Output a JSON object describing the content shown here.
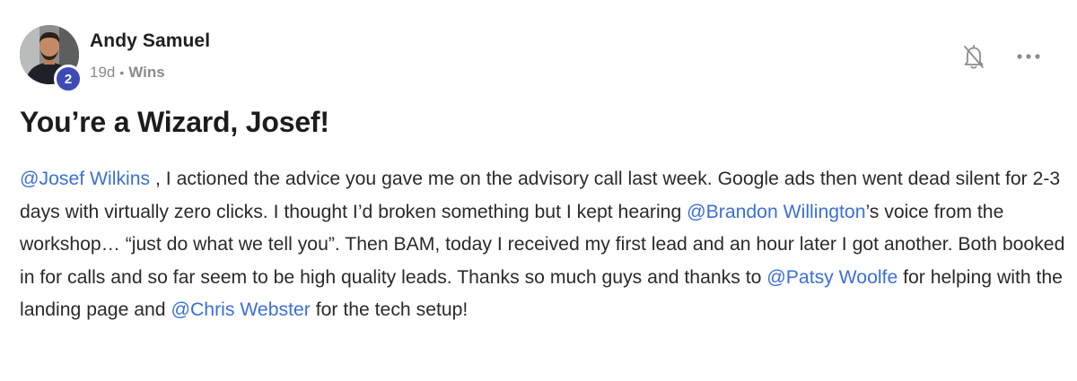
{
  "post": {
    "author": {
      "name": "Andy Samuel",
      "level": "2",
      "avatar_icon": "user-avatar-photo"
    },
    "meta": {
      "time": "19d",
      "separator": "•",
      "category": "Wins"
    },
    "actions": {
      "bell_icon": "bell-off-icon",
      "more_icon": "more-horizontal-icon"
    },
    "title": "You’re a Wizard, Josef!",
    "body": {
      "mention_1": "@Josef Wilkins",
      "text_1": " , I actioned the advice you gave me on the advisory call last week. Google ads then went dead silent for 2-3 days with virtually zero clicks. I thought I’d broken something but I kept hearing ",
      "mention_2": "@Brandon Willington",
      "text_2": "’s voice from the workshop… “just do what we tell you”. Then BAM, today I received my first lead and an hour later I got another. Both booked in for calls and so far seem to be high quality leads. Thanks so much guys and thanks to ",
      "mention_3": "@Patsy Woolfe",
      "text_3": " for helping with the landing page and ",
      "mention_4": "@Chris Webster",
      "text_4": " for the tech setup!"
    },
    "colors": {
      "mention": "#3b6fd8",
      "badge": "#3d4ab8",
      "muted": "#8a8a8a",
      "text": "#2a2a2a"
    }
  }
}
